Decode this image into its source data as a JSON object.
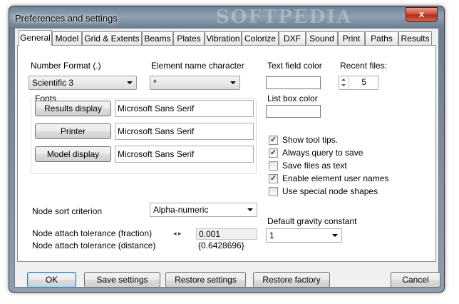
{
  "window": {
    "title": "Preferences and settings",
    "watermark": "SOFTPEDIA",
    "close_symbol": "x"
  },
  "tabs": [
    {
      "label": "General",
      "active": true
    },
    {
      "label": "Model"
    },
    {
      "label": "Grid & Extents"
    },
    {
      "label": "Beams"
    },
    {
      "label": "Plates"
    },
    {
      "label": "Vibration"
    },
    {
      "label": "Colorize"
    },
    {
      "label": "DXF"
    },
    {
      "label": "Sound"
    },
    {
      "label": "Print"
    },
    {
      "label": "Paths"
    },
    {
      "label": "Results"
    }
  ],
  "general": {
    "number_format": {
      "label": "Number Format (.)",
      "value": "Scientific 3"
    },
    "element_name_character": {
      "label": "Element name character",
      "value": "*"
    },
    "text_field_color": {
      "label": "Text field color"
    },
    "list_box_color": {
      "label": "List box color"
    },
    "recent_files": {
      "label": "Recent files:",
      "value": "5"
    },
    "fonts": {
      "label": "Fonts",
      "rows": [
        {
          "button": "Results display",
          "value": "Microsoft Sans Serif"
        },
        {
          "button": "Printer",
          "value": "Microsoft Sans Serif"
        },
        {
          "button": "Model display",
          "value": "Microsoft Sans Serif"
        }
      ]
    },
    "checkboxes": [
      {
        "label": "Show tool tips.",
        "checked": true
      },
      {
        "label": "Always query to save",
        "checked": true
      },
      {
        "label": "Save files as text",
        "checked": false
      },
      {
        "label": "Enable element user names",
        "checked": true
      },
      {
        "label": "Use special node shapes",
        "checked": false
      }
    ],
    "node_sort": {
      "label": "Node sort criterion",
      "value": "Alpha-numeric"
    },
    "gravity": {
      "label": "Default gravity constant",
      "value": "1"
    },
    "attach_fraction": {
      "label": "Node attach tolerance (fraction)",
      "value": "0.001"
    },
    "attach_distance": {
      "label": "Node attach tolerance (distance)",
      "value": "{0.6428696}"
    }
  },
  "buttons": {
    "ok": "OK",
    "save_settings": "Save settings",
    "restore_settings": "Restore settings",
    "restore_factory": "Restore factory",
    "cancel": "Cancel"
  },
  "check_mark": "✓"
}
